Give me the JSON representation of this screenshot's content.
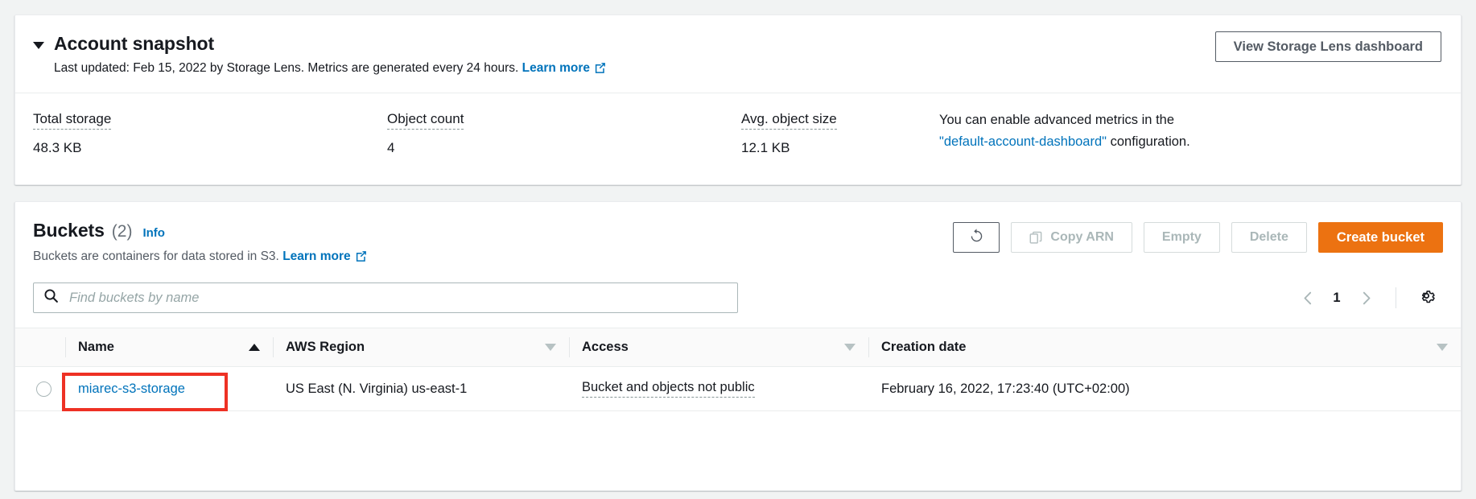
{
  "snapshot": {
    "title": "Account snapshot",
    "collapse_icon": "caret-down-icon",
    "subtitle_text": "Last updated: Feb 15, 2022 by Storage Lens. Metrics are generated every 24 hours.",
    "subtitle_link": "Learn more",
    "view_dashboard_button": "View Storage Lens dashboard",
    "metrics": [
      {
        "label": "Total storage",
        "value": "48.3 KB"
      },
      {
        "label": "Object count",
        "value": "4"
      },
      {
        "label": "Avg. object size",
        "value": "12.1 KB"
      }
    ],
    "advanced_notice_line1": "You can enable advanced metrics in the",
    "advanced_notice_link": "\"default-account-dashboard\"",
    "advanced_notice_line2": "configuration."
  },
  "buckets": {
    "title": "Buckets",
    "count": "(2)",
    "info_label": "Info",
    "description": "Buckets are containers for data stored in S3.",
    "description_link": "Learn more",
    "actions": {
      "refresh_icon": "refresh-icon",
      "copy_arn": "Copy ARN",
      "empty": "Empty",
      "delete": "Delete",
      "create_bucket": "Create bucket"
    },
    "search": {
      "placeholder": "Find buckets by name",
      "value": "",
      "icon": "search-icon"
    },
    "pagination": {
      "prev_icon": "chevron-left-icon",
      "current_page": "1",
      "next_icon": "chevron-right-icon",
      "settings_icon": "gear-icon"
    },
    "table": {
      "columns": [
        {
          "label": "Name",
          "sort": "asc"
        },
        {
          "label": "AWS Region",
          "sort": "none"
        },
        {
          "label": "Access",
          "sort": "none"
        },
        {
          "label": "Creation date",
          "sort": "none"
        }
      ],
      "rows": [
        {
          "name": "miarec-s3-storage",
          "region": "US East (N. Virginia) us-east-1",
          "access": "Bucket and objects not public",
          "creation_date": "February 16, 2022, 17:23:40 (UTC+02:00)"
        }
      ]
    }
  },
  "colors": {
    "accent_orange": "#ec7211",
    "link_blue": "#0073bb",
    "annotation_red": "#ee3124",
    "page_background": "#f1f3f3",
    "text_dark": "#16191f"
  }
}
